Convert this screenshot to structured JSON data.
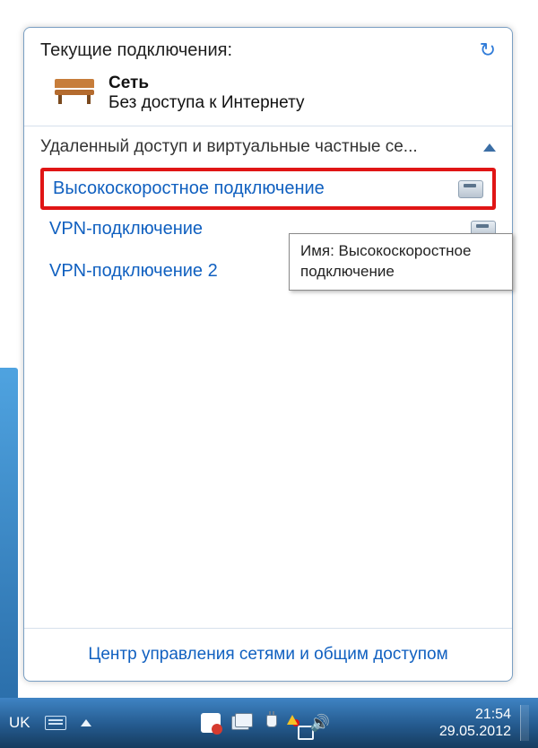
{
  "header": {
    "title": "Текущие подключения:"
  },
  "current": {
    "name": "Сеть",
    "status": "Без доступа к Интернету"
  },
  "section": {
    "title": "Удаленный доступ и виртуальные частные се..."
  },
  "connections": [
    {
      "label": "Высокоскоростное подключение",
      "icon": "modem",
      "highlighted": true
    },
    {
      "label": "VPN-подключение",
      "icon": "modem",
      "highlighted": false
    },
    {
      "label": "VPN-подключение 2",
      "icon": "server",
      "highlighted": false
    }
  ],
  "tooltip": {
    "text": "Имя: Высокоскоростное подключение"
  },
  "footer": {
    "link": "Центр управления сетями и общим доступом"
  },
  "taskbar": {
    "lang": "UK",
    "time": "21:54",
    "date": "29.05.2012"
  }
}
